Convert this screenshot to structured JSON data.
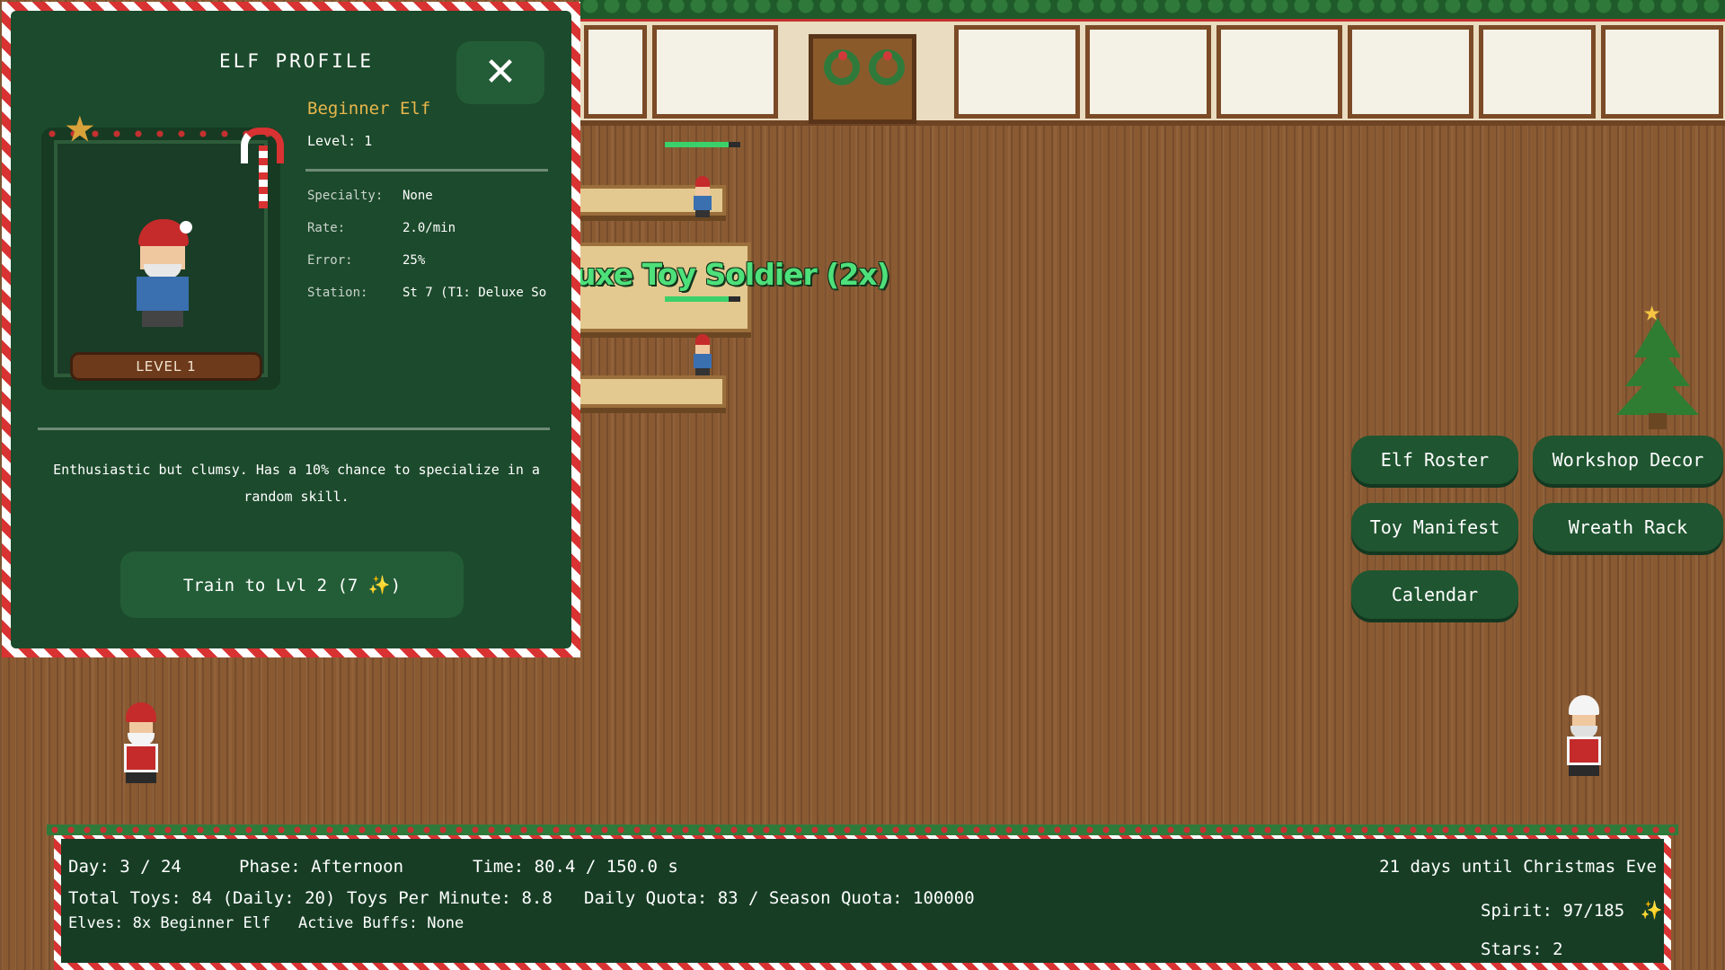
{
  "profile": {
    "title": "ELF PROFILE",
    "close_icon": "close-icon",
    "elf_name": "Beginner Elf",
    "level_text": "Level: 1",
    "level_plate": "LEVEL 1",
    "stats": {
      "specialty_label": "Specialty:",
      "specialty_value": "None",
      "rate_label": "Rate:",
      "rate_value": "2.0/min",
      "error_label": "Error:",
      "error_value": "25%",
      "station_label": "Station:",
      "station_value": "St 7 (T1: Deluxe So"
    },
    "description": "Enthusiastic but clumsy. Has a 10% chance to specialize in a random skill.",
    "train_button": "Train to Lvl 2 (7",
    "train_button_suffix": ")",
    "train_icon": "sparkle-icon"
  },
  "workshop": {
    "floating_label": "uxe Toy Soldier (2x)"
  },
  "menu": {
    "elf_roster": "Elf Roster",
    "workshop_decor": "Workshop Decor",
    "toy_manifest": "Toy Manifest",
    "wreath_rack": "Wreath Rack",
    "calendar": "Calendar"
  },
  "status": {
    "day": "Day: 3 / 24",
    "phase": "Phase: Afternoon",
    "time": "Time: 80.4 / 150.0 s",
    "countdown": "21 days until Christmas Eve",
    "total_toys": "Total Toys: 84 (Daily: 20)",
    "toys_per_minute": "Toys Per Minute: 8.8",
    "quota": "Daily Quota: 83 / Season Quota: 100000",
    "elves": "Elves: 8x Beginner Elf",
    "active_buffs": "Active Buffs:  None",
    "spirit": "Spirit: 97/185",
    "spirit_icon": "sparkle-icon",
    "stars": "Stars: 2"
  },
  "colors": {
    "panel_green": "#1c4a2c",
    "button_green": "#235d37",
    "accent_gold": "#e8b74c",
    "label_green": "#4ee07a",
    "candy_red": "#d83232"
  }
}
